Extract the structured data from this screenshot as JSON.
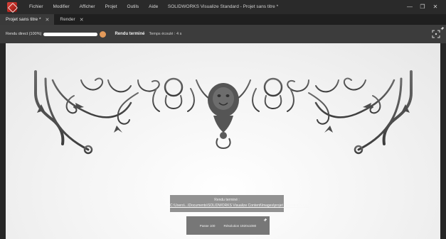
{
  "window": {
    "title": "SOLIDWORKS Visualize Standard - Projet sans titre *",
    "controls": {
      "minimize": "—",
      "restore": "❐",
      "close": "✕"
    }
  },
  "menu": {
    "items": [
      {
        "label": "Fichier"
      },
      {
        "label": "Modifier"
      },
      {
        "label": "Afficher"
      },
      {
        "label": "Projet"
      },
      {
        "label": "Outils"
      },
      {
        "label": "Aide"
      }
    ]
  },
  "tabs": [
    {
      "label": "Projet sans titre *",
      "active": true,
      "close": "✕"
    },
    {
      "label": "Render",
      "active": false,
      "close": "✕"
    }
  ],
  "render_toolbar": {
    "direct_label": "Rendu direct (100%)",
    "progress_percent": 100,
    "status_label": "Rendu terminé",
    "elapsed_label": "Temps écoulé : 4 s"
  },
  "toast": {
    "title": "Rendu terminé :",
    "path": "C:\\Users\\...\\Documents\\SOLIDWORKS Visualize Content\\Images\\projet sans titre 3D.jpg"
  },
  "info": {
    "passes": "Passe 100",
    "resolution": "Résolution 1920x1080"
  },
  "colors": {
    "titlebar": "#2a2a2a",
    "tabbar": "#1f1f1f",
    "toolbar": "#3c3c3c",
    "render_knob": "#e39a5a",
    "ornament": "#4a4a4a",
    "viewport": "#f3f3f3"
  }
}
